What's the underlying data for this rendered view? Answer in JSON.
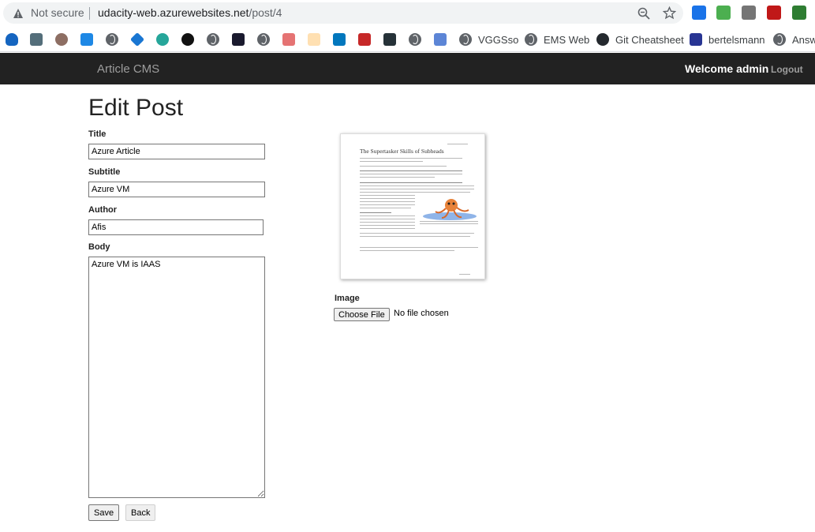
{
  "browser": {
    "security_text": "Not secure",
    "url_host": "udacity-web.azurewebsites.net",
    "url_path": "/post/4",
    "colors": {
      "omnibox_bg": "#f1f3f4"
    }
  },
  "bookmarks": [
    {
      "label": "",
      "icon": "octopus-icon"
    },
    {
      "label": "",
      "icon": "stack-icon"
    },
    {
      "label": "",
      "icon": "person-icon"
    },
    {
      "label": "",
      "icon": "xing-icon"
    },
    {
      "label": "",
      "icon": "globe-icon"
    },
    {
      "label": "",
      "icon": "diamond-icon"
    },
    {
      "label": "",
      "icon": "shield-icon"
    },
    {
      "label": "",
      "icon": "seven-icon"
    },
    {
      "label": "",
      "icon": "globe-icon"
    },
    {
      "label": "",
      "icon": "sparkle-icon"
    },
    {
      "label": "",
      "icon": "globe-icon"
    },
    {
      "label": "",
      "icon": "jpg-pdf-icon"
    },
    {
      "label": "",
      "icon": "w-icon"
    },
    {
      "label": "",
      "icon": "api-icon"
    },
    {
      "label": "",
      "icon": "pd-icon"
    },
    {
      "label": "",
      "icon": "chatgpt-icon"
    },
    {
      "label": "",
      "icon": "globe-icon"
    },
    {
      "label": "",
      "icon": "r-icon"
    },
    {
      "label": "VGGSso",
      "icon": "globe-icon"
    },
    {
      "label": "EMS Web",
      "icon": "globe-icon"
    },
    {
      "label": "Git Cheatsheet",
      "icon": "github-icon"
    },
    {
      "label": "bertelsmann",
      "icon": "window-icon"
    },
    {
      "label": "Answ",
      "icon": "globe-icon"
    }
  ],
  "navbar": {
    "brand": "Article CMS",
    "welcome": "Welcome admin",
    "logout": "Logout"
  },
  "form": {
    "heading": "Edit Post",
    "title_label": "Title",
    "title_value": "Azure Article",
    "subtitle_label": "Subtitle",
    "subtitle_value": "Azure VM",
    "author_label": "Author",
    "author_value": "Afis",
    "body_label": "Body",
    "body_value": "Azure VM is IAAS",
    "save_label": "Save",
    "back_label": "Back"
  },
  "image": {
    "label": "Image",
    "choose_file": "Choose File",
    "no_file": "No file chosen",
    "thumbnail_title": "The Supertasker Skills of Subheads"
  }
}
